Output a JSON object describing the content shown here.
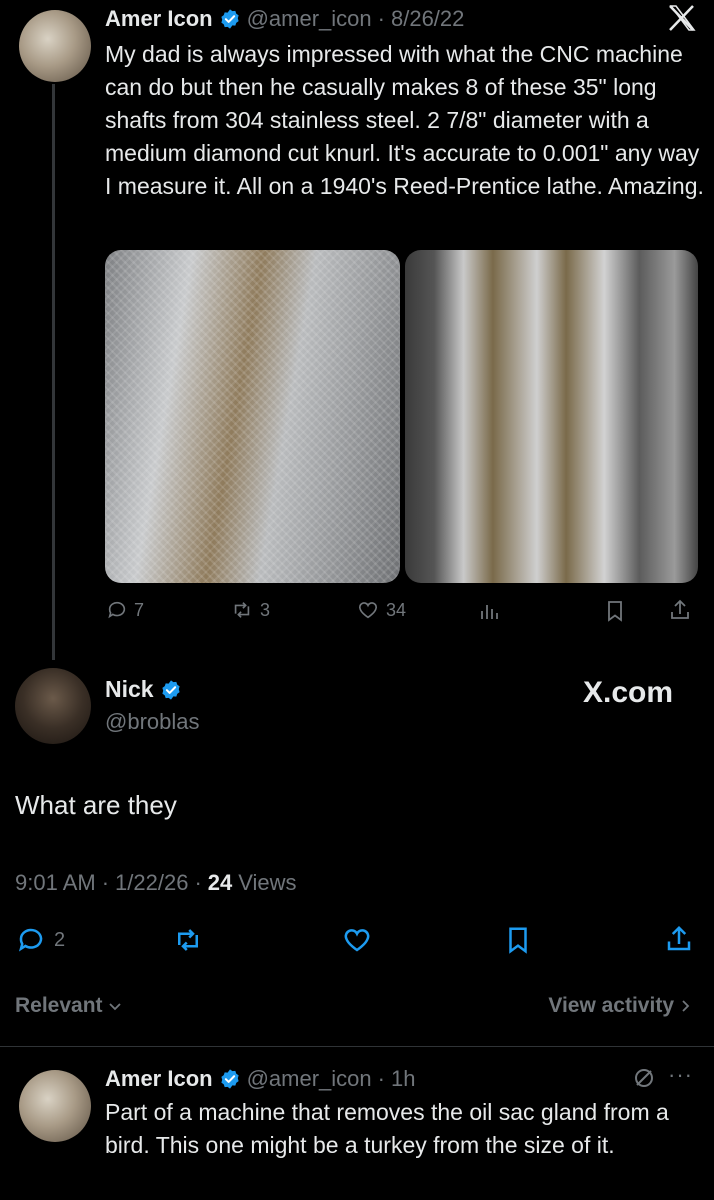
{
  "tweet1": {
    "name": "Amer Icon",
    "handle": "@amer_icon",
    "date": "8/26/22",
    "body": "My dad is always impressed with what the CNC machine can do but then he casually makes 8 of these 35\" long shafts from 304 stainless steel. 2 7/8\" diameter with a medium diamond cut knurl. It's accurate to 0.001\" any way I measure it. All on a 1940's Reed-Prentice lathe. Amazing.",
    "replies": "7",
    "reposts": "3",
    "likes": "34",
    "x_logo": "X"
  },
  "tweet2": {
    "name": "Nick",
    "handle": "@broblas",
    "watermark": "X.com",
    "body": "What are they",
    "time": "9:01 AM",
    "date": "1/22/26",
    "views_count": "24",
    "views_label": "Views",
    "replies": "2"
  },
  "sort": {
    "label": "Relevant",
    "view_activity": "View activity"
  },
  "reply": {
    "name": "Amer Icon",
    "handle": "@amer_icon",
    "age": "1h",
    "body": "Part of a machine that removes the oil sac gland from a bird. This one might be a turkey from the size of it.",
    "more": "···"
  },
  "colors": {
    "background": "#000000",
    "text": "#e7e9ea",
    "muted": "#71767b",
    "accent": "#1d9bf0"
  }
}
